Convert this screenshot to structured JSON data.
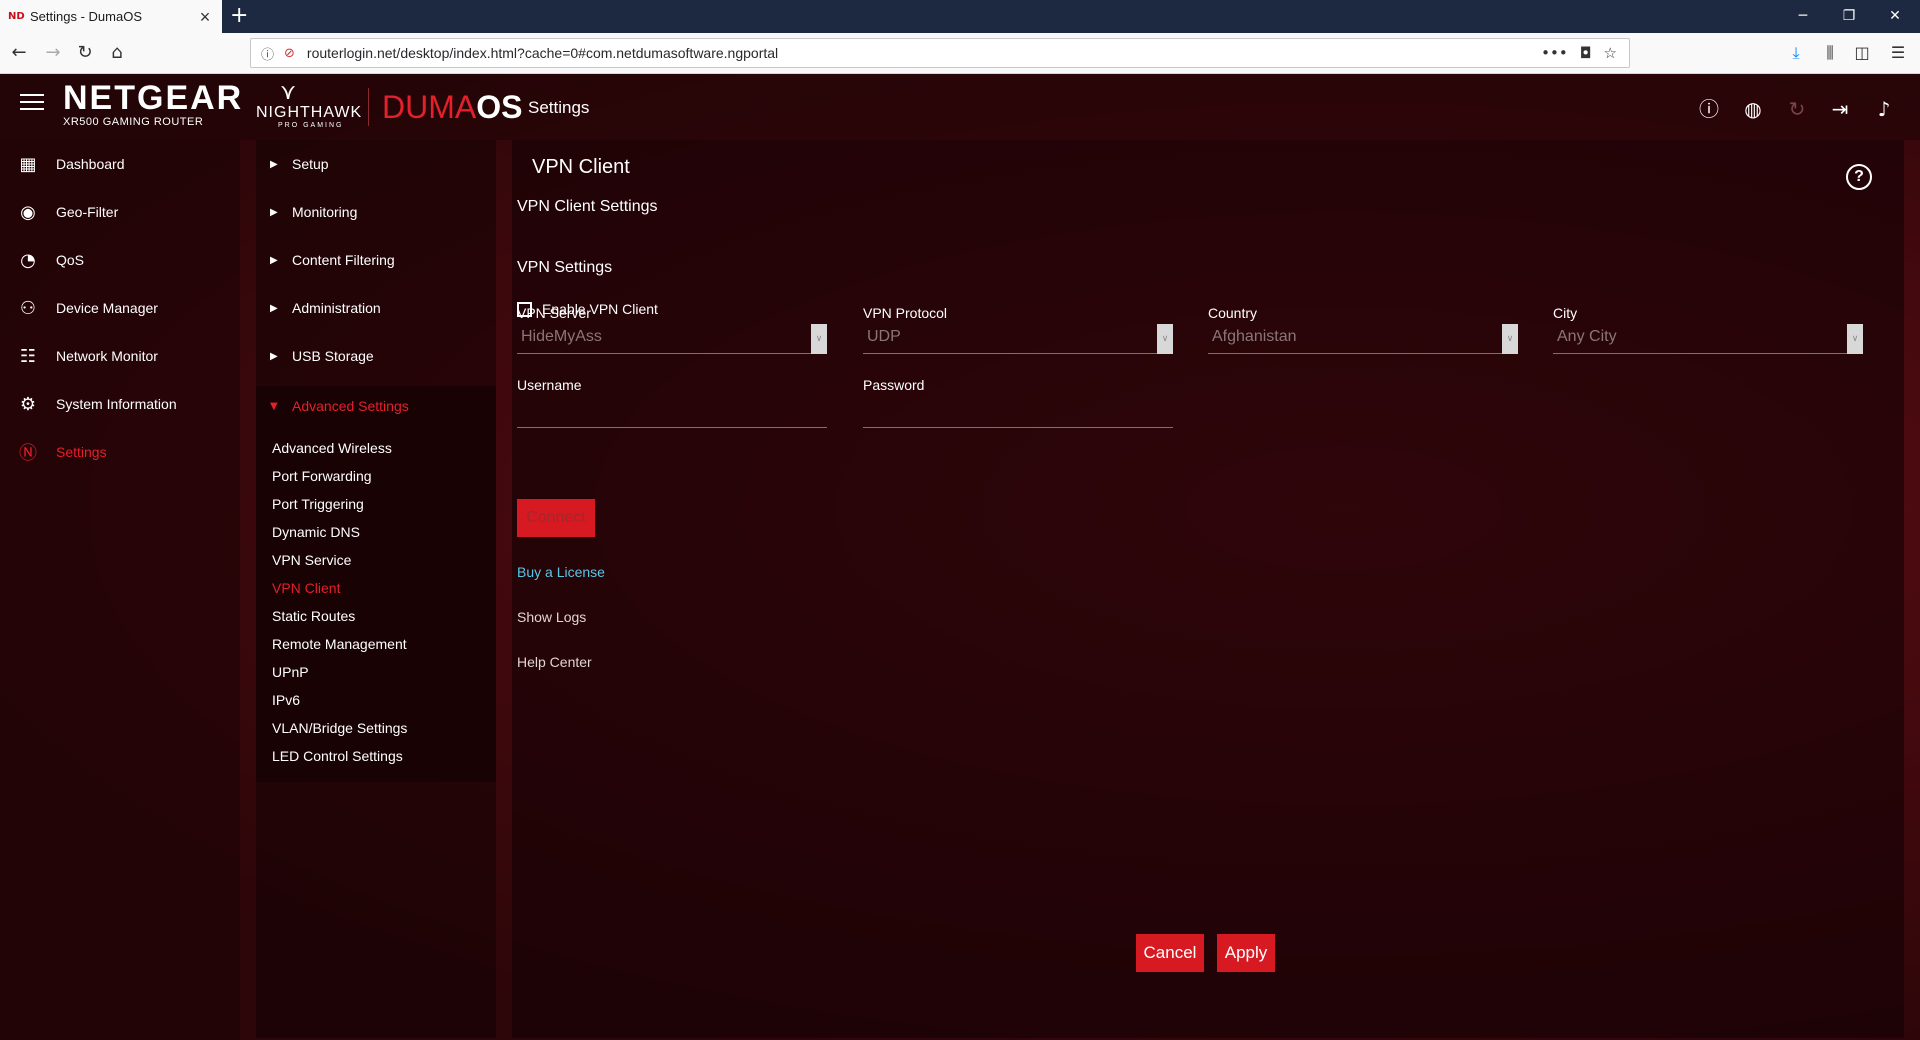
{
  "browser": {
    "tab_title": "Settings - DumaOS",
    "tab_favicon": "ND",
    "url": "routerlogin.net/desktop/index.html?cache=0#com.netdumasoftware.ngportal",
    "url_more": "•••"
  },
  "header": {
    "brand": "NETGEAR",
    "model": "XR500 GAMING ROUTER",
    "nighthawk": "NIGHTHAWK",
    "pro_gaming": "PRO GAMING",
    "duma_1": "DUMA",
    "duma_2": "OS",
    "title": "Settings"
  },
  "left_nav": [
    {
      "label": "Dashboard",
      "icon": "dashboard-icon"
    },
    {
      "label": "Geo-Filter",
      "icon": "geo-filter-icon"
    },
    {
      "label": "QoS",
      "icon": "qos-icon"
    },
    {
      "label": "Device Manager",
      "icon": "device-manager-icon"
    },
    {
      "label": "Network Monitor",
      "icon": "network-monitor-icon"
    },
    {
      "label": "System Information",
      "icon": "system-information-icon"
    },
    {
      "label": "Settings",
      "icon": "settings-icon"
    }
  ],
  "sub_nav": {
    "sections": [
      "Setup",
      "Monitoring",
      "Content Filtering",
      "Administration",
      "USB Storage"
    ],
    "advanced": "Advanced Settings",
    "advanced_items": [
      "Advanced Wireless",
      "Port Forwarding",
      "Port Triggering",
      "Dynamic DNS",
      "VPN Service",
      "VPN Client",
      "Static Routes",
      "Remote Management",
      "UPnP",
      "IPv6",
      "VLAN/Bridge Settings",
      "LED Control Settings"
    ]
  },
  "content": {
    "title": "VPN Client",
    "client_settings": "VPN Client Settings",
    "enable_label": "Enable VPN Client",
    "vpn_settings": "VPN Settings",
    "server_label": "VPN Server",
    "server_value": "HideMyAss",
    "protocol_label": "VPN Protocol",
    "protocol_value": "UDP",
    "country_label": "Country",
    "country_value": "Afghanistan",
    "city_label": "City",
    "city_value": "Any City",
    "username_label": "Username",
    "password_label": "Password",
    "connect": "Connect",
    "buy_license": "Buy a License",
    "show_logs": "Show Logs",
    "help_center": "Help Center",
    "cancel": "Cancel",
    "apply": "Apply"
  },
  "colors": {
    "accent": "#e3202b",
    "link": "#59c6e6"
  }
}
